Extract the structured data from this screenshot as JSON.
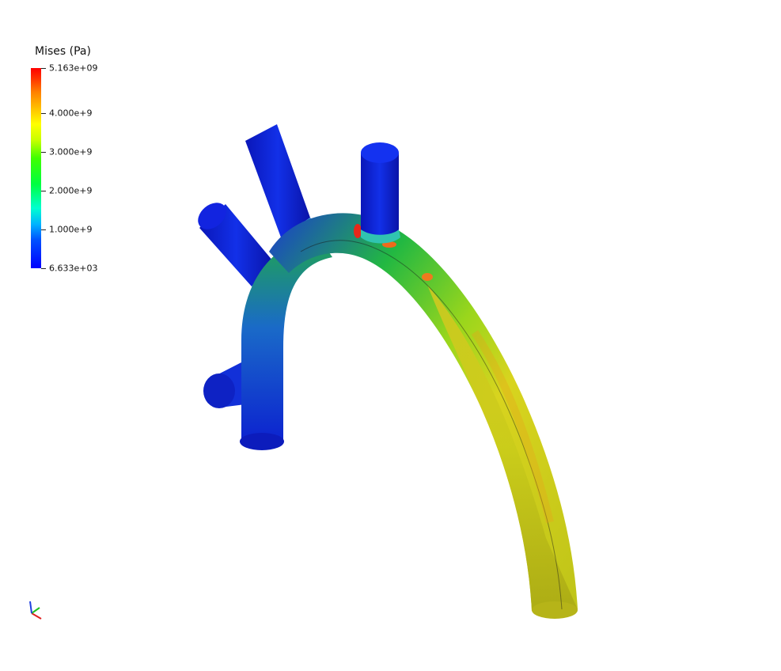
{
  "legend": {
    "title": "Mises (Pa)",
    "colormap": [
      "#0000ff",
      "#00b4ff",
      "#00ff40",
      "#c8ff00",
      "#ffff00",
      "#ff8000",
      "#ff0000"
    ],
    "max_label": "5.163e+09",
    "min_label": "6.633e+03",
    "ticks": [
      {
        "label": "4.000e+9"
      },
      {
        "label": "3.000e+9"
      },
      {
        "label": "2.000e+9"
      },
      {
        "label": "1.000e+9"
      }
    ]
  },
  "scene": {
    "model": "aortic-arch-mesh",
    "colors": {
      "low": "#0a1ad8",
      "mid": "#2cc83a",
      "high": "#d6d81e",
      "peak": "#e8281a"
    }
  },
  "axes": {
    "x_color": "#e02020",
    "y_color": "#20c020",
    "z_color": "#2040e0"
  }
}
